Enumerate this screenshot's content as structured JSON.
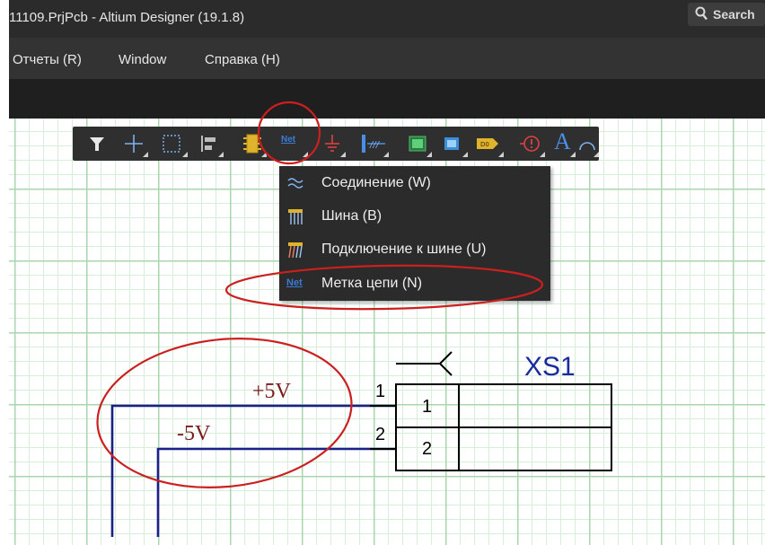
{
  "window": {
    "title": "11109.PrjPcb - Altium Designer (19.1.8)"
  },
  "search": {
    "label": "Search"
  },
  "menu": {
    "items": [
      {
        "label": "Отчеты (R)"
      },
      {
        "label": "Window"
      },
      {
        "label": "Справка (H)"
      }
    ]
  },
  "toolbar": {
    "net_label_text": "Net",
    "text_tool_glyph": "A",
    "tools": [
      "filter-icon",
      "crosshair-icon",
      "selection-rect-icon",
      "align-icon",
      "component-icon",
      "net-label-icon",
      "ground-power-icon",
      "bus-entry-icon",
      "sheet-symbol-icon",
      "port-icon",
      "directive-icon",
      "text-icon",
      "arc-icon"
    ]
  },
  "dropdown": {
    "items": [
      {
        "label": "Соединение (W)",
        "icon": "wire-icon"
      },
      {
        "label": "Шина (B)",
        "icon": "bus-icon"
      },
      {
        "label": "Подключение к шине (U)",
        "icon": "bus-entry-icon"
      },
      {
        "label": "Метка цепи (N)",
        "icon": "net-label-icon"
      }
    ]
  },
  "schematic": {
    "net_plus": "+5V",
    "net_minus": "-5V",
    "connector_designator": "XS1",
    "pin1_number": "1",
    "pin2_number": "2",
    "pin1_name": "1",
    "pin2_name": "2"
  },
  "colors": {
    "titlebar_bg": "#2b2b2b",
    "menubar_bg": "#333333",
    "toolbar_bg": "#2f2f2f",
    "grid_major": "#a9d6ae",
    "grid_minor": "#d7eedb",
    "wire": "#1c1f8a",
    "net_label_text": "#7a1b1b",
    "designator": "#1a2aa0",
    "annotation": "#cc1f1f",
    "accent_blue": "#3a7bd5"
  }
}
